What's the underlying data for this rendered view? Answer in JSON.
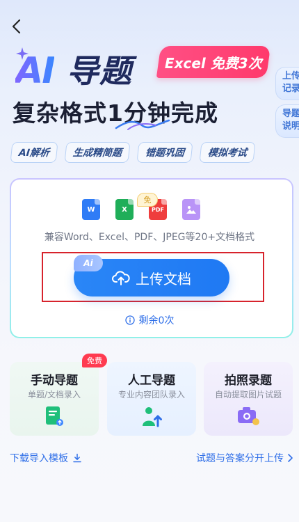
{
  "hero": {
    "ai_text": "AI",
    "title": "导题",
    "badge": "Excel 免费3次",
    "subtitle": "复杂格式1分钟完成"
  },
  "tags": [
    "AI解析",
    "生成精简题",
    "错题巩固",
    "模拟考试"
  ],
  "side_buttons": {
    "upload_record": "上传\n记录",
    "guide": "导题\n说明"
  },
  "upload_card": {
    "formats": [
      "W",
      "X",
      "PDF",
      ""
    ],
    "free_chip": "免",
    "compat_text": "兼容Word、Excel、PDF、JPEG等20+文档格式",
    "ai_chip": "Ai",
    "upload_button": "上传文档",
    "remaining": "剩余0次"
  },
  "modes": [
    {
      "title": "手动导题",
      "sub": "单题/文档录入"
    },
    {
      "title": "人工导题",
      "sub": "专业内容团队录入"
    },
    {
      "title": "拍照录题",
      "sub": "自动提取图片试题"
    }
  ],
  "free_tag": "免费",
  "links": {
    "download_template": "下载导入模板",
    "split_upload": "试题与答案分开上传"
  },
  "colors": {
    "primary": "#1f79f3",
    "badge_pink": "#ff3a6c",
    "highlight_red": "#d7232c"
  }
}
